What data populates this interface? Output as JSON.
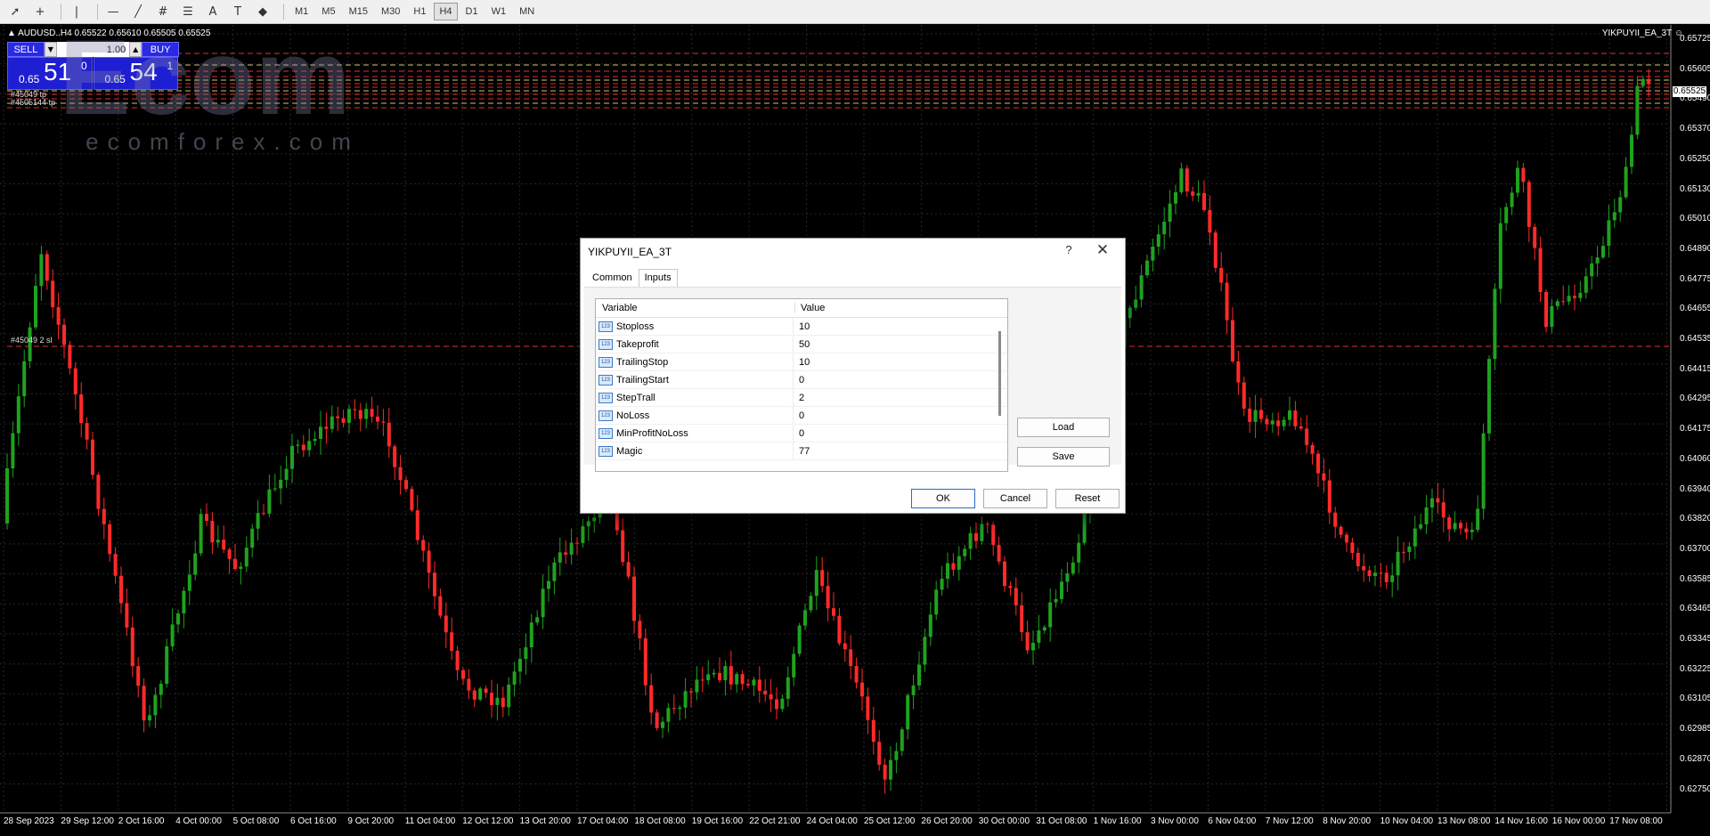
{
  "toolbar": {
    "tools": [
      {
        "name": "cursor-icon",
        "glyph": "➚"
      },
      {
        "name": "crosshair-icon",
        "glyph": "+"
      },
      {
        "name": "vertical-line-icon",
        "glyph": "|"
      },
      {
        "name": "horizontal-line-icon",
        "glyph": "—"
      },
      {
        "name": "trendline-icon",
        "glyph": "╱"
      },
      {
        "name": "channel-icon",
        "glyph": "#"
      },
      {
        "name": "fibonacci-icon",
        "glyph": "☰"
      },
      {
        "name": "text-icon",
        "glyph": "A"
      },
      {
        "name": "label-icon",
        "glyph": "T"
      },
      {
        "name": "shapes-icon",
        "glyph": "◆"
      }
    ],
    "timeframes": [
      "M1",
      "M5",
      "M15",
      "M30",
      "H1",
      "H4",
      "D1",
      "W1",
      "MN"
    ],
    "active_timeframe": "H4"
  },
  "chart": {
    "symbol_info": "▲ AUDUSD..H4  0.65522 0.65610 0.65505 0.65525",
    "ea_name": "YIKPUYII_EA_3T ☺",
    "colors": {
      "bull": "#1fa21f",
      "bear": "#ff2a2a",
      "grid": "#262626",
      "order_line": "#e03030"
    },
    "price_axis": [
      "0.65725",
      "0.65605",
      "0.65490",
      "0.65370",
      "0.65250",
      "0.65130",
      "0.65010",
      "0.64890",
      "0.64775",
      "0.64655",
      "0.64535",
      "0.64415",
      "0.64295",
      "0.64175",
      "0.64060",
      "0.63940",
      "0.63820",
      "0.63700",
      "0.63585",
      "0.63465",
      "0.63345",
      "0.63225",
      "0.63105",
      "0.62985",
      "0.62870",
      "0.62750"
    ],
    "current_price": "0.65525",
    "dates": [
      "28 Sep 2023",
      "29 Sep 12:00",
      "2 Oct 16:00",
      "4 Oct 00:00",
      "5 Oct 08:00",
      "6 Oct 16:00",
      "9 Oct 20:00",
      "11 Oct 04:00",
      "12 Oct 12:00",
      "13 Oct 20:00",
      "17 Oct 04:00",
      "18 Oct 08:00",
      "19 Oct 16:00",
      "22 Oct 21:00",
      "24 Oct 04:00",
      "25 Oct 12:00",
      "26 Oct 20:00",
      "30 Oct 00:00",
      "31 Oct 08:00",
      "1 Nov 16:00",
      "3 Nov 00:00",
      "6 Nov 04:00",
      "7 Nov 12:00",
      "8 Nov 20:00",
      "10 Nov 04:00",
      "13 Nov 08:00",
      "14 Nov 16:00",
      "16 Nov 00:00",
      "17 Nov 08:00"
    ],
    "order_labels": {
      "top1": "#45049 tp",
      "top2": "#4505144 tp",
      "sl": "#45049  2 sl"
    }
  },
  "trade_panel": {
    "sell_label": "SELL",
    "buy_label": "BUY",
    "lot": "1.00",
    "bid_small": "0.65",
    "bid_big": "51",
    "bid_sup": "0",
    "ask_small": "0.65",
    "ask_big": "54",
    "ask_sup": "1"
  },
  "dialog": {
    "title": "YIKPUYII_EA_3T",
    "help": "?",
    "tabs": [
      "Common",
      "Inputs"
    ],
    "active_tab": "Inputs",
    "columns": {
      "variable": "Variable",
      "value": "Value"
    },
    "rows": [
      {
        "icon": "123",
        "variable": "Stoploss",
        "value": "10"
      },
      {
        "icon": "123",
        "variable": "Takeprofit",
        "value": "50"
      },
      {
        "icon": "123",
        "variable": "TrailingStop",
        "value": "10"
      },
      {
        "icon": "123",
        "variable": "TrailingStart",
        "value": "0"
      },
      {
        "icon": "123",
        "variable": "StepTrall",
        "value": "2"
      },
      {
        "icon": "123",
        "variable": "NoLoss",
        "value": "0"
      },
      {
        "icon": "123",
        "variable": "MinProfitNoLoss",
        "value": "0"
      },
      {
        "icon": "123",
        "variable": "Magic",
        "value": "77"
      }
    ],
    "buttons": {
      "load": "Load",
      "save": "Save",
      "ok": "OK",
      "cancel": "Cancel",
      "reset": "Reset"
    }
  },
  "watermark": {
    "brand": "ecomforex.com",
    "logo": "Ecom"
  }
}
